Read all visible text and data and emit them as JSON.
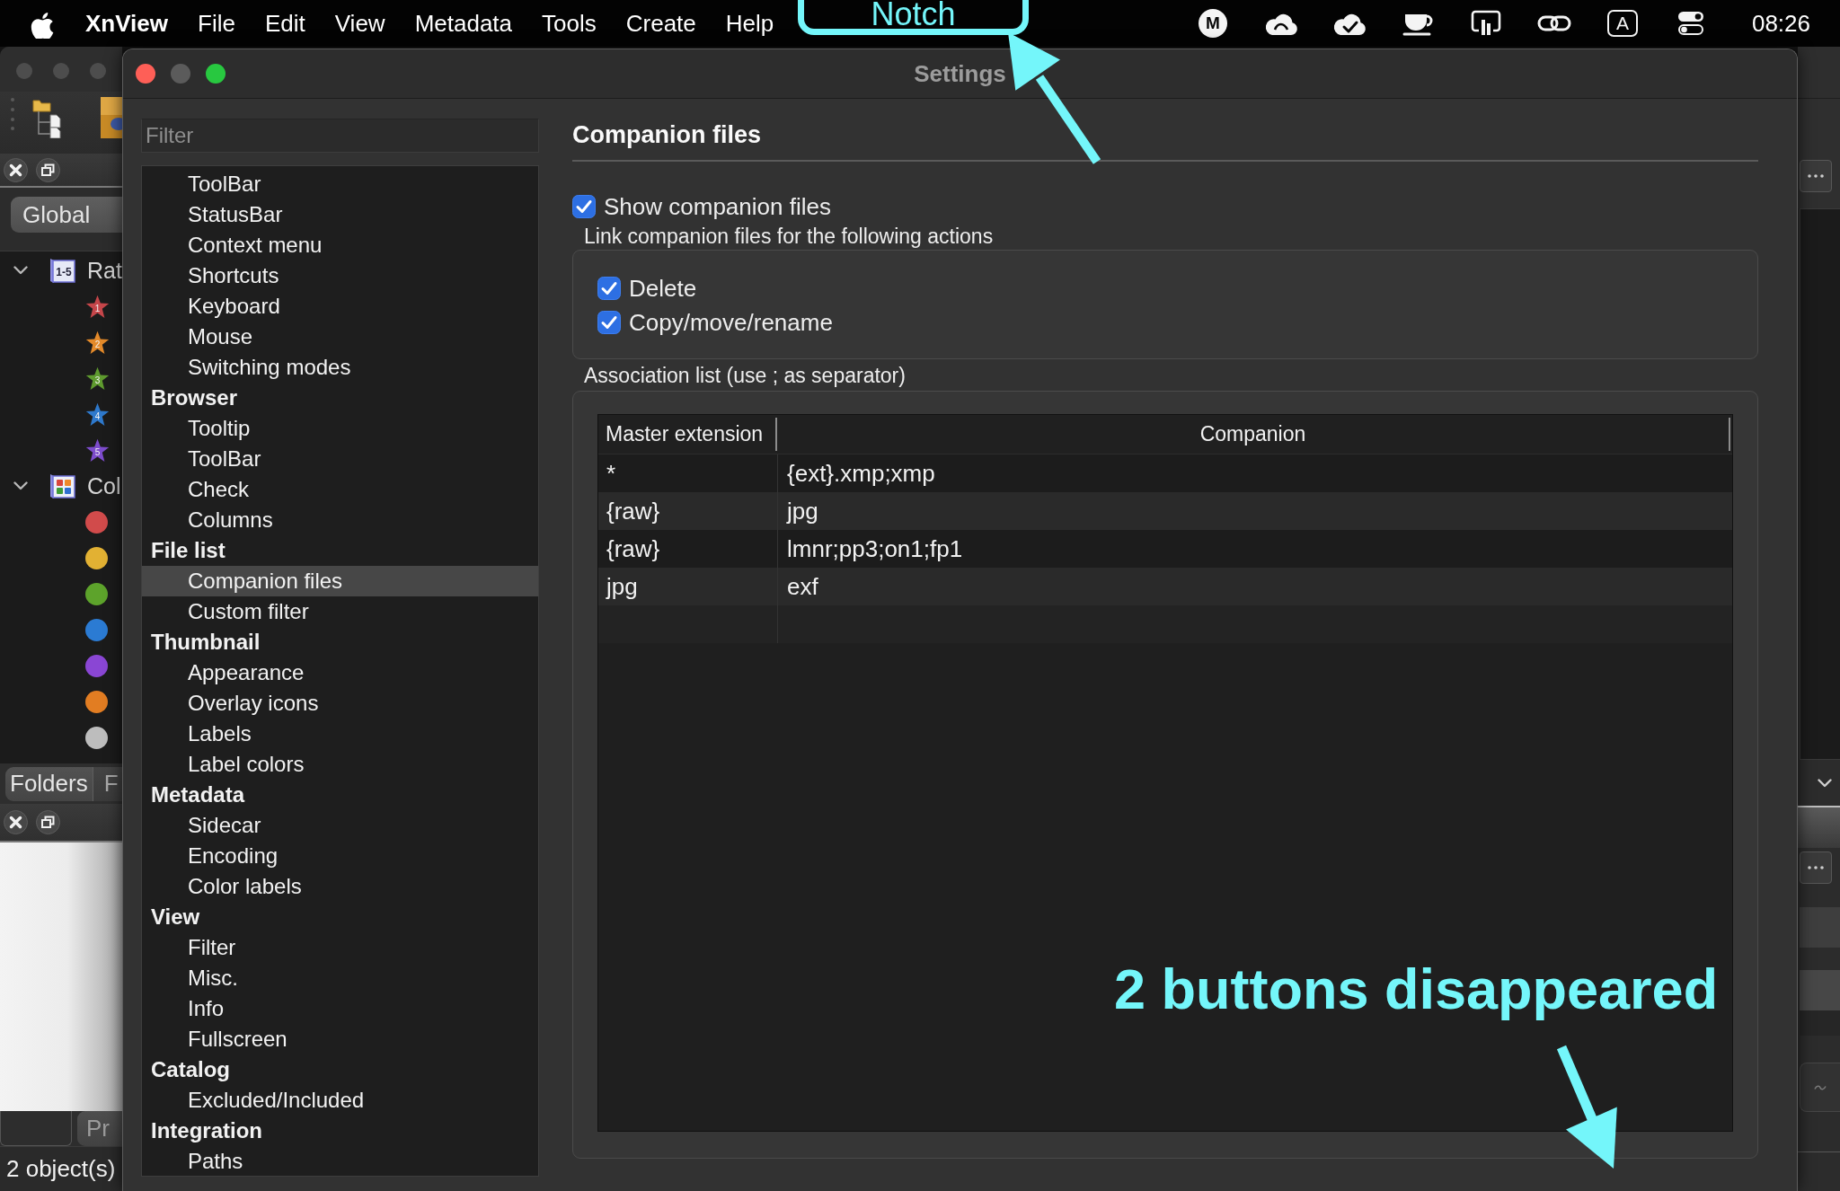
{
  "menu_bar": {
    "app_name": "XnView",
    "menus": [
      "File",
      "Edit",
      "View",
      "Metadata",
      "Tools",
      "Create",
      "Help"
    ],
    "status_letter": "M",
    "input_source": "A",
    "clock": "08:26"
  },
  "background_window": {
    "scope_tab": "Global",
    "tree": [
      {
        "kind": "stars",
        "label": "Rat",
        "badge": "1-5",
        "expanded": true,
        "children": [
          {
            "label": "1",
            "color": "#c6464a"
          },
          {
            "label": "2",
            "color": "#e48a2a"
          },
          {
            "label": "3",
            "color": "#5f9b2f"
          },
          {
            "label": "4",
            "color": "#2e79cc"
          },
          {
            "label": "5",
            "color": "#7d4ccc"
          }
        ]
      },
      {
        "kind": "dots",
        "label": "Col",
        "expanded": true,
        "children": [
          {
            "color": "#d14b4b"
          },
          {
            "color": "#e2b133"
          },
          {
            "color": "#5da32b"
          },
          {
            "color": "#2b7bd3"
          },
          {
            "color": "#8a46d4"
          },
          {
            "color": "#e27d22"
          },
          {
            "color": "#bdbdbd"
          }
        ]
      }
    ],
    "tabs": [
      {
        "label": "Folders",
        "selected": true
      },
      {
        "label": "F",
        "selected": false
      }
    ],
    "bottom_tab": "Pr",
    "status": "2 object(s)"
  },
  "settings_window": {
    "title": "Settings",
    "filter": {
      "placeholder": "Filter"
    },
    "tree": [
      {
        "children": [
          {
            "label": "ToolBar",
            "selected": false
          },
          {
            "label": "StatusBar",
            "selected": false
          },
          {
            "label": "Context menu",
            "selected": false
          },
          {
            "label": "Shortcuts",
            "selected": false
          },
          {
            "label": "Keyboard",
            "selected": false
          },
          {
            "label": "Mouse",
            "selected": false
          },
          {
            "label": "Switching modes",
            "selected": false
          }
        ]
      },
      {
        "label": "Browser",
        "selected": false,
        "children": [
          {
            "label": "Tooltip",
            "selected": false
          },
          {
            "label": "ToolBar",
            "selected": false
          },
          {
            "label": "Check",
            "selected": false
          },
          {
            "label": "Columns",
            "selected": false
          }
        ]
      },
      {
        "label": "File list",
        "selected": false,
        "children": [
          {
            "label": "Companion files",
            "selected": true
          },
          {
            "label": "Custom filter",
            "selected": false
          }
        ]
      },
      {
        "label": "Thumbnail",
        "selected": false,
        "children": [
          {
            "label": "Appearance",
            "selected": false
          },
          {
            "label": "Overlay icons",
            "selected": false
          },
          {
            "label": "Labels",
            "selected": false
          },
          {
            "label": "Label colors",
            "selected": false
          }
        ]
      },
      {
        "label": "Metadata",
        "selected": false,
        "children": [
          {
            "label": "Sidecar",
            "selected": false
          },
          {
            "label": "Encoding",
            "selected": false
          },
          {
            "label": "Color labels",
            "selected": false
          }
        ]
      },
      {
        "label": "View",
        "selected": false,
        "children": [
          {
            "label": "Filter",
            "selected": false
          },
          {
            "label": "Misc.",
            "selected": false
          },
          {
            "label": "Info",
            "selected": false
          },
          {
            "label": "Fullscreen",
            "selected": false
          }
        ]
      },
      {
        "label": "Catalog",
        "selected": false,
        "children": [
          {
            "label": "Excluded/Included",
            "selected": false
          }
        ]
      },
      {
        "label": "Integration",
        "selected": false,
        "children": [
          {
            "label": "Paths",
            "selected": false
          }
        ]
      }
    ],
    "page": {
      "heading": "Companion files",
      "show_companion": {
        "label": "Show companion files",
        "checked": true
      },
      "link_group": {
        "title": "Link companion files for the following actions",
        "options": [
          {
            "label": "Delete",
            "checked": true
          },
          {
            "label": "Copy/move/rename",
            "checked": true
          }
        ]
      },
      "association": {
        "title": "Association list (use ; as separator)",
        "table": {
          "columns": [
            "Master extension",
            "Companion"
          ],
          "rows": [
            [
              "*",
              "{ext}.xmp;xmp"
            ],
            [
              "{raw}",
              "jpg"
            ],
            [
              "{raw}",
              "lmnr;pp3;on1;fp1"
            ],
            [
              "jpg",
              "exf"
            ]
          ]
        }
      }
    }
  },
  "annotations": [
    {
      "kind": "notch",
      "text": "Notch"
    },
    {
      "kind": "note",
      "text": "2 buttons disappeared"
    }
  ]
}
